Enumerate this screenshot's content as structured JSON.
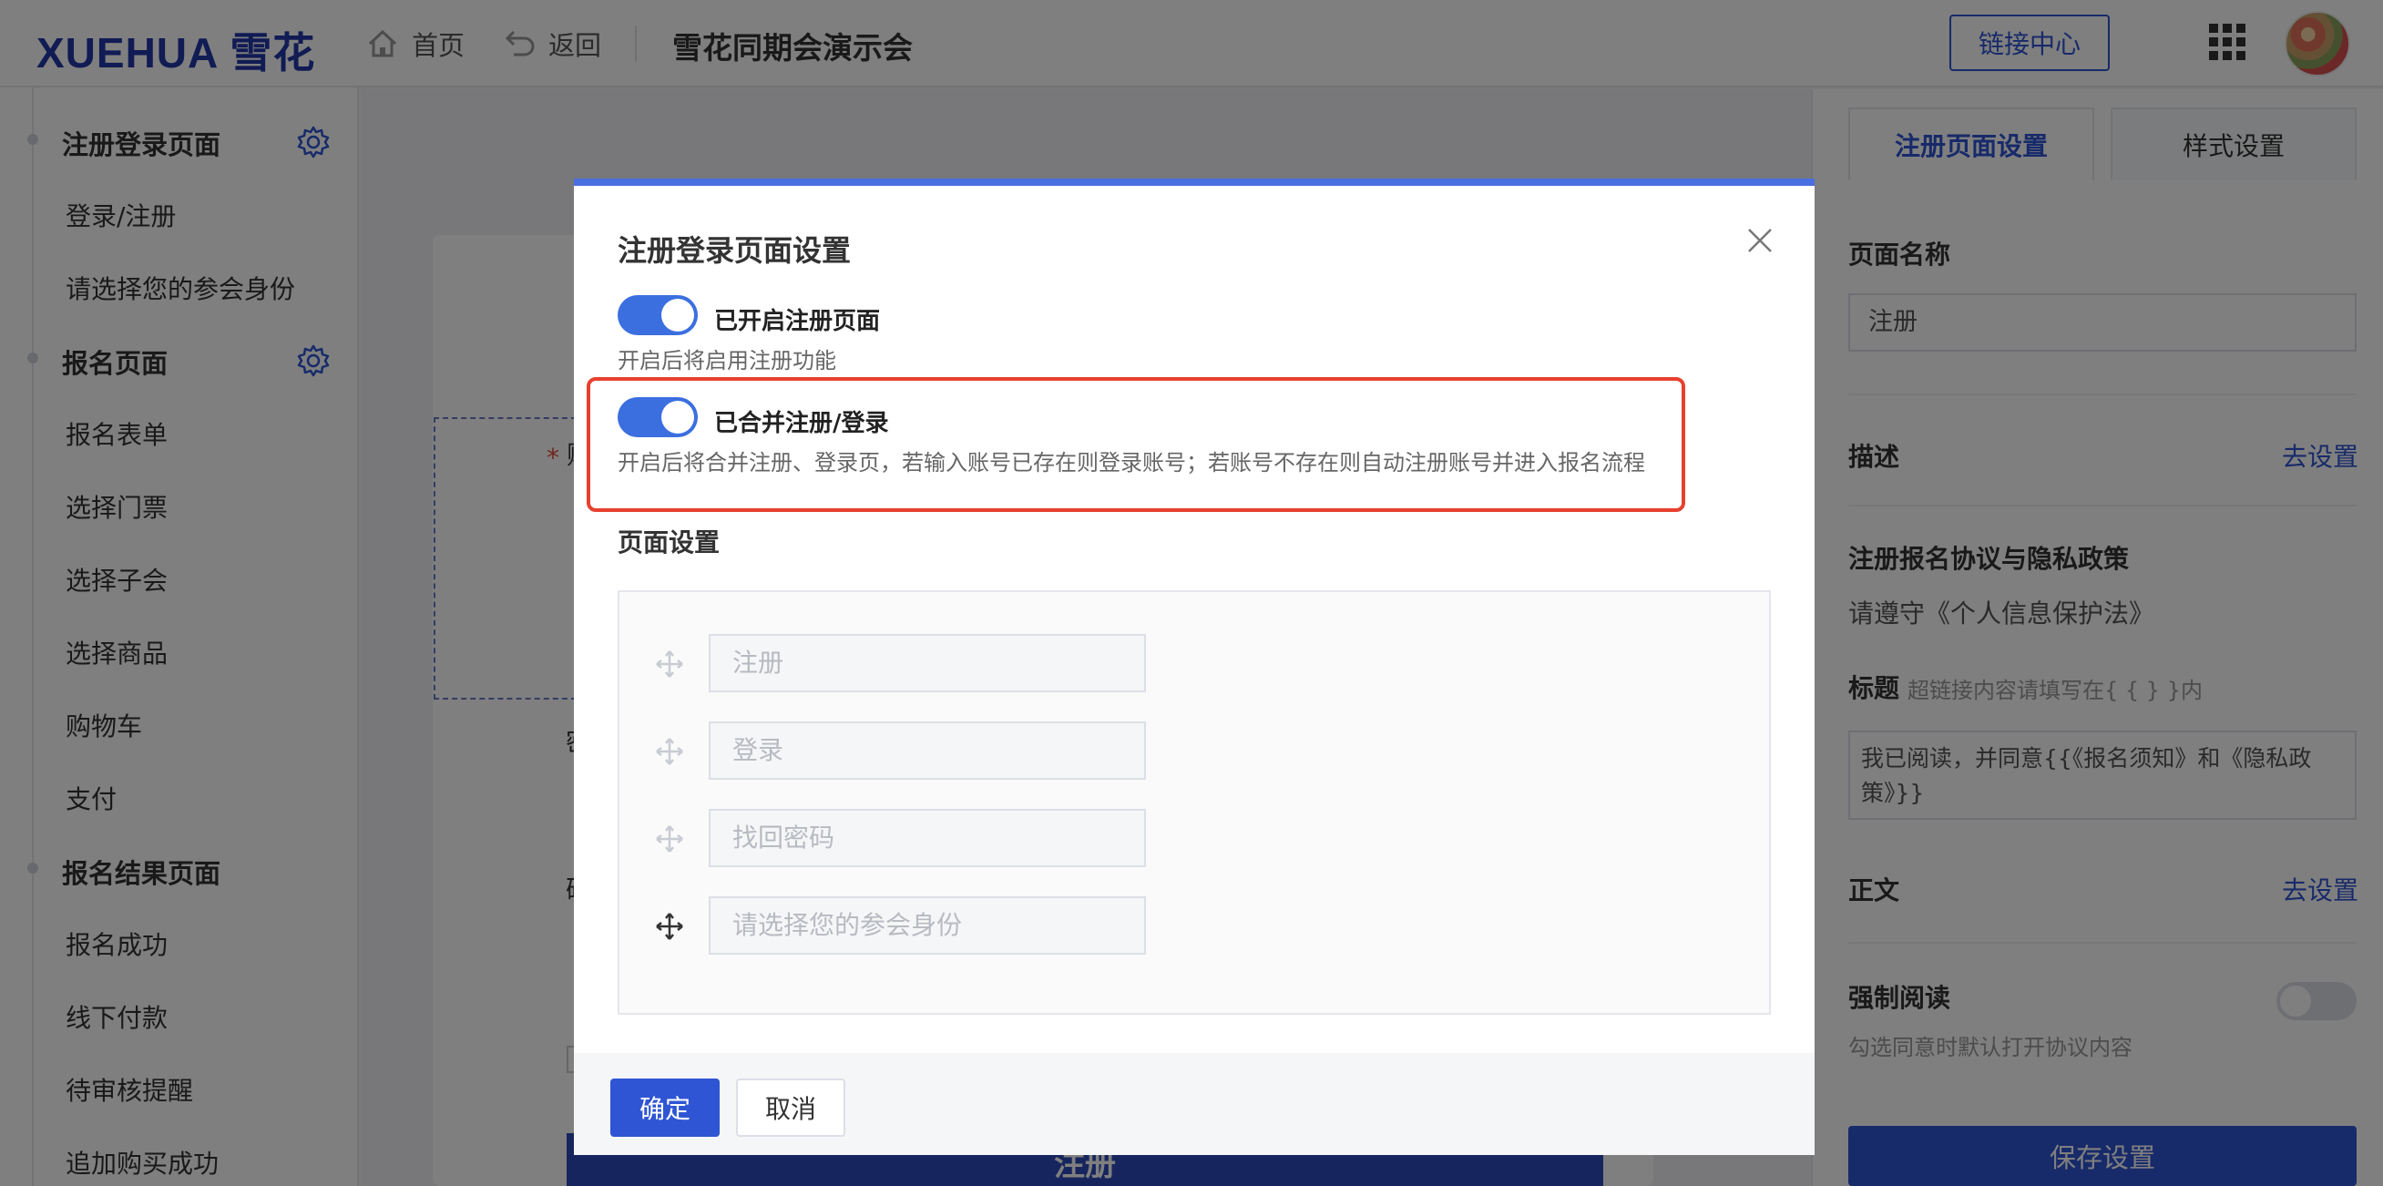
{
  "header": {
    "logo": "XUEHUA 雪花",
    "nav": {
      "home": "首页",
      "back": "返回"
    },
    "title": "雪花同期会演示会",
    "link_center": "链接中心"
  },
  "sidebar": {
    "sections": [
      {
        "label": "注册登录页面",
        "items": [
          "登录/注册",
          "请选择您的参会身份"
        ]
      },
      {
        "label": "报名页面",
        "items": [
          "报名表单",
          "选择门票",
          "选择子会",
          "选择商品",
          "购物车",
          "支付"
        ]
      },
      {
        "label": "报名结果页面",
        "items": [
          "报名成功",
          "线下付款",
          "待审核提醒",
          "追加购买成功"
        ]
      }
    ]
  },
  "canvas": {
    "partial_1": "账",
    "partial_2": "密",
    "partial_3": "确",
    "bottom_button": "注册"
  },
  "right_panel": {
    "tabs": [
      "注册页面设置",
      "样式设置"
    ],
    "page_name_label": "页面名称",
    "page_name_value": "注册",
    "description_label": "描述",
    "description_link": "去设置",
    "agreement_label": "注册报名协议与隐私政策",
    "agreement_text": "请遵守《个人信息保护法》",
    "title_label": "标题",
    "title_hint": "超链接内容请填写在{ {   } }内",
    "title_value": "我已阅读，并同意{{《报名须知》和《隐私政策》}}",
    "body_label": "正文",
    "body_link": "去设置",
    "force_read_label": "强制阅读",
    "force_read_hint": "勾选同意时默认打开协议内容",
    "save_button": "保存设置"
  },
  "modal": {
    "title": "注册登录页面设置",
    "option1_label": "已开启注册页面",
    "option1_desc": "开启后将启用注册功能",
    "option1_on": true,
    "option2_label": "已合并注册/登录",
    "option2_desc": "开启后将合并注册、登录页，若输入账号已存在则登录账号；若账号不存在则自动注册账号并进入报名流程",
    "option2_on": true,
    "section_title": "页面设置",
    "page_items": [
      "注册",
      "登录",
      "找回密码",
      "请选择您的参会身份"
    ],
    "ok_button": "确定",
    "cancel_button": "取消"
  },
  "colors": {
    "brand": "#2337a8",
    "primary": "#2f55d4",
    "toggle_on": "#3b6fe0",
    "highlight": "#e8402f"
  }
}
